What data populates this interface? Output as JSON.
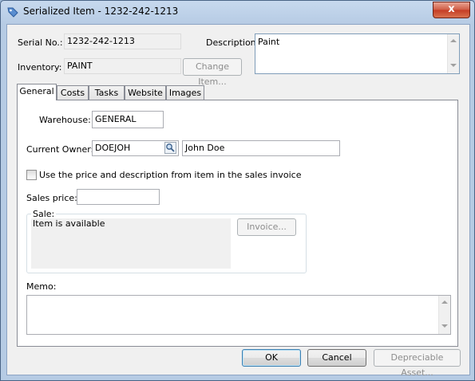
{
  "window": {
    "title": "Serialized Item - 1232-242-1213",
    "close_glyph": "x"
  },
  "fields": {
    "serial_label": "Serial No.:",
    "serial_value": "1232-242-1213",
    "inventory_label": "Inventory:",
    "inventory_value": "PAINT",
    "change_item_button": "Change Item...",
    "description_label": "Description:",
    "description_value": "Paint"
  },
  "tabs": [
    {
      "label": "General",
      "active": true
    },
    {
      "label": "Costs"
    },
    {
      "label": "Tasks"
    },
    {
      "label": "Website"
    },
    {
      "label": "Images"
    }
  ],
  "general": {
    "warehouse_label": "Warehouse:",
    "warehouse_value": "GENERAL",
    "owner_label": "Current Owner:",
    "owner_code": "DOEJOH",
    "owner_name": "John Doe",
    "use_price_label": "Use the price and description from item in the sales invoice",
    "use_price_checked": false,
    "sales_price_label": "Sales price:",
    "sales_price_value": "",
    "sale_group_label": "Sale:",
    "sale_status": "Item is available",
    "invoice_button": "Invoice...",
    "memo_label": "Memo:",
    "memo_value": ""
  },
  "footer": {
    "ok_button": "OK",
    "cancel_button": "Cancel",
    "depreciable_button": "Depreciable Asset..."
  },
  "icons": [
    "app-tag-icon",
    "lookup-magnifier-icon",
    "close-icon"
  ]
}
